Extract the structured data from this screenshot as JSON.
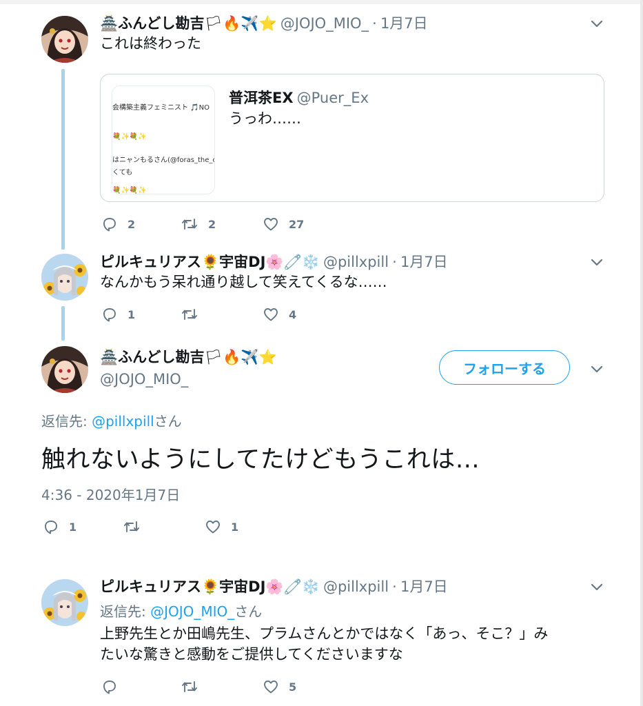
{
  "tweet1": {
    "display_name": "ふんどし勘吉",
    "emojis": [
      "🏯",
      "🏳",
      "🔥",
      "✈️",
      "⭐"
    ],
    "handle": "@JOJO_MIO_",
    "dot": "·",
    "date": "1月7日",
    "text": "これは終わった",
    "quote": {
      "display_name": "普洱茶EX",
      "handle": "@Puer_Ex",
      "text": "うっわ……",
      "thumb_lines": [
        "会構築主義フェミニスト 🎵NO",
        "💐✨💐✨",
        "はニャンもるさん(@foras_the_ca",
        "くても",
        "💐✨💐✨"
      ]
    },
    "reply_count": "2",
    "retweet_count": "2",
    "like_count": "27"
  },
  "tweet2": {
    "display_name": "ピルキュリアス",
    "emoji_a": "🌻",
    "name_part2": "宇宙DJ",
    "emojis_b": [
      "🌸",
      "🧷",
      "❄️"
    ],
    "handle": "@pillxpill",
    "dot": "·",
    "date": "1月7日",
    "text": "なんかもう呆れ通り越して笑えてくるな……",
    "reply_count": "1",
    "like_count": "4"
  },
  "main_tweet": {
    "display_name": "ふんどし勘吉",
    "emojis": [
      "🏯",
      "🏳",
      "🔥",
      "✈️",
      "⭐"
    ],
    "handle": "@JOJO_MIO_",
    "follow_label": "フォローする",
    "reply_prefix": "返信先: ",
    "reply_to": "@pillxpill",
    "reply_suffix": "さん",
    "text": "触れないようにしてたけどもうこれは…",
    "timestamp": "4:36 - 2020年1月7日",
    "reply_count": "1",
    "like_count": "1"
  },
  "tweet4": {
    "display_name": "ピルキュリアス",
    "emoji_a": "🌻",
    "name_part2": "宇宙DJ",
    "emojis_b": [
      "🌸",
      "🧷",
      "❄️"
    ],
    "handle": "@pillxpill",
    "dot": "·",
    "date": "1月7日",
    "reply_prefix": "返信先: ",
    "reply_to": "@JOJO_MIO_",
    "reply_suffix": "さん",
    "text_line1": "上野先生とか田嶋先生、プラムさんとかではなく「あっ、そこ？」み",
    "text_line2": "たいな驚きと感動をご提供してくださいますな",
    "like_count": "5"
  },
  "colors": {
    "accent": "#1da1f2",
    "thread_line": "#a4d4f2",
    "secondary_text": "#657786",
    "border": "#ccd6dd"
  },
  "icons": [
    "reply-icon",
    "retweet-icon",
    "like-icon",
    "chevron-down-icon"
  ]
}
